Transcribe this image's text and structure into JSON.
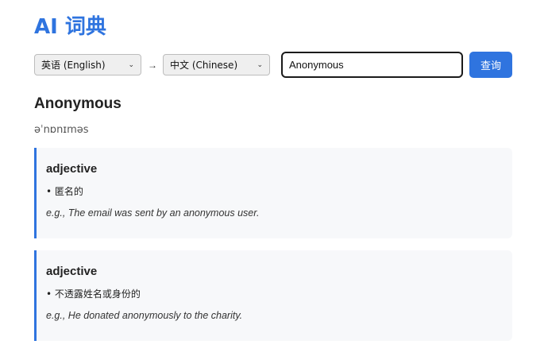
{
  "app": {
    "title": "AI 词典"
  },
  "controls": {
    "source_language": "英语 (English)",
    "arrow": "→",
    "target_language": "中文 (Chinese)",
    "search_value": "Anonymous",
    "search_button_label": "查询"
  },
  "result": {
    "word": "Anonymous",
    "phonetic": "əˈnɒnɪməs",
    "definitions": [
      {
        "part_of_speech": "adjective",
        "meaning": "• 匿名的",
        "example": "e.g., The email was sent by an anonymous user."
      },
      {
        "part_of_speech": "adjective",
        "meaning": "• 不透露姓名或身份的",
        "example": "e.g., He donated anonymously to the charity."
      }
    ]
  },
  "colors": {
    "accent": "#2f74df",
    "card_bg": "#f7f8fa"
  },
  "icons": {
    "select_chevron": "chevron-down-icon"
  }
}
